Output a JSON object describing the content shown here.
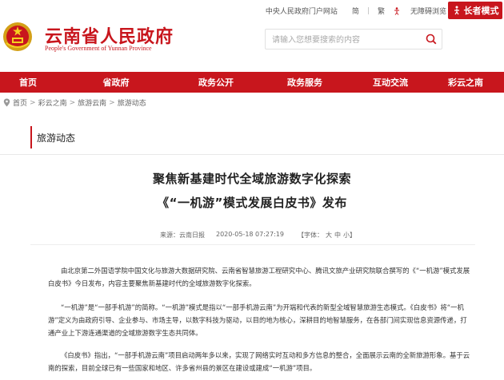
{
  "topbar": {
    "central_portal": "中央人民政府门户网站",
    "simplified": "简",
    "traditional": "繁",
    "accessible": "无障碍浏览",
    "elder_mode": "长者模式"
  },
  "header": {
    "title": "云南省人民政府",
    "subtitle": "People's Government of Yunnan Province",
    "search_placeholder": "请输入您想要搜索的内容"
  },
  "nav": {
    "items": [
      {
        "label": "首页"
      },
      {
        "label": "省政府"
      },
      {
        "label": "政务公开"
      },
      {
        "label": "政务服务"
      },
      {
        "label": "互动交流"
      },
      {
        "label": "彩云之南"
      }
    ]
  },
  "breadcrumb": {
    "items": [
      "首页",
      "彩云之南",
      "旅游云南",
      "旅游动态"
    ]
  },
  "section": {
    "label": "旅游动态"
  },
  "article": {
    "title_line1": "聚焦新基建时代全域旅游数字化探索",
    "title_line2": "《“一机游”模式发展白皮书》发布",
    "source": "来源：云南日报",
    "date": "2020-05-18 07:27:19",
    "font_label": "【字体：",
    "font_large": "大",
    "font_medium": "中",
    "font_small": "小】",
    "paragraphs": [
      "由北京第二外国语学院中国文化与旅游大数据研究院、云南省智慧旅游工程研究中心、腾讯文旅产业研究院联合撰写的《“一机游”模式发展白皮书》今日发布，内容主要聚焦新基建时代的全域旅游数字化探索。",
      "“一机游”是“一部手机游”的简称。“一机游”模式是指以“一部手机游云南”为开端和代表的新型全域智慧旅游生态模式。《白皮书》将“一机游”定义为由政府引导、企业参与、市场主导，以数字科技为驱动，以目的地为核心，深耕目的地智慧服务，在各部门间实现信息资源传递，打通产业上下游连通渠道的全域旅游数字生态共同体。",
      "《白皮书》指出，“一部手机游云南”项目启动两年多以来，实现了网络实时互动和多方信息的整合，全面展示云南的全新旅游形象。基于云南的探索，目前全球已有一些国家和地区、许多省州县的景区在建设或建成“一机游”项目。"
    ]
  },
  "colors": {
    "brand_red": "#c8161d"
  }
}
